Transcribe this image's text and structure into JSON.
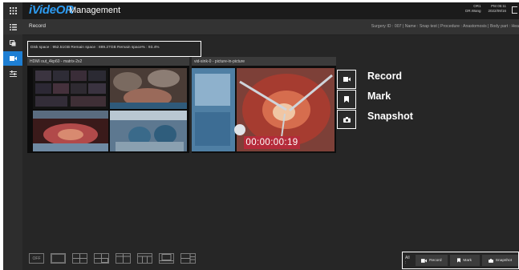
{
  "topbar": {
    "brand": "iVideOR",
    "title": "Management",
    "room": "OR1",
    "time": "PM 05:11",
    "user": "DR.Wang",
    "date": "2022/09/16"
  },
  "subbar": {
    "title": "Record",
    "info": "Surgery ID : 007 | Name : Snap test | Procedure : Anastomosis | Body part : Hea"
  },
  "disk": {
    "text": "Disk space : 952.51GB   Remain space : 889.27GB   Remain space% : 93.4%"
  },
  "panels": {
    "left_title": "HDMI out_4kp60 - matrix-2x2",
    "right_title": "vid-sink-0 - picture-in-picture"
  },
  "timer": "00:00:00:19",
  "side_actions": {
    "record": "Record",
    "mark": "Mark",
    "snapshot": "Snapshot"
  },
  "layout_buttons": {
    "off": "OFF"
  },
  "bottom_actions": {
    "all": "All :",
    "record": "Record",
    "mark": "Mark",
    "snapshot": "Snapshot"
  },
  "colors": {
    "brand": "#2d9bf0",
    "active_nav": "#1e7fd4",
    "timer_bg": "#b52b3a"
  }
}
